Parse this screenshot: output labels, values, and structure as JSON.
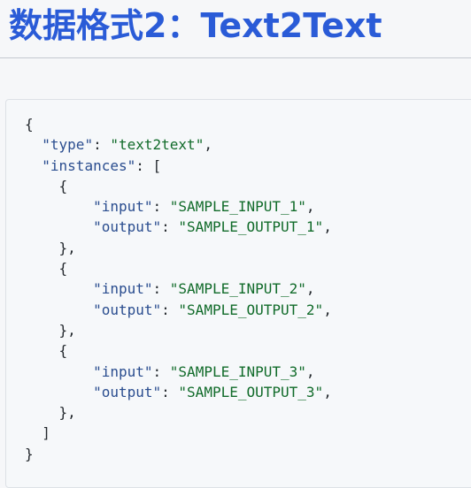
{
  "heading": "数据格式2：Text2Text",
  "code": {
    "type_key": "type",
    "type_value": "text2text",
    "instances_key": "instances",
    "input_key": "input",
    "output_key": "output",
    "instances": [
      {
        "input": "SAMPLE_INPUT_1",
        "output": "SAMPLE_OUTPUT_1"
      },
      {
        "input": "SAMPLE_INPUT_2",
        "output": "SAMPLE_OUTPUT_2"
      },
      {
        "input": "SAMPLE_INPUT_3",
        "output": "SAMPLE_OUTPUT_3"
      }
    ]
  }
}
